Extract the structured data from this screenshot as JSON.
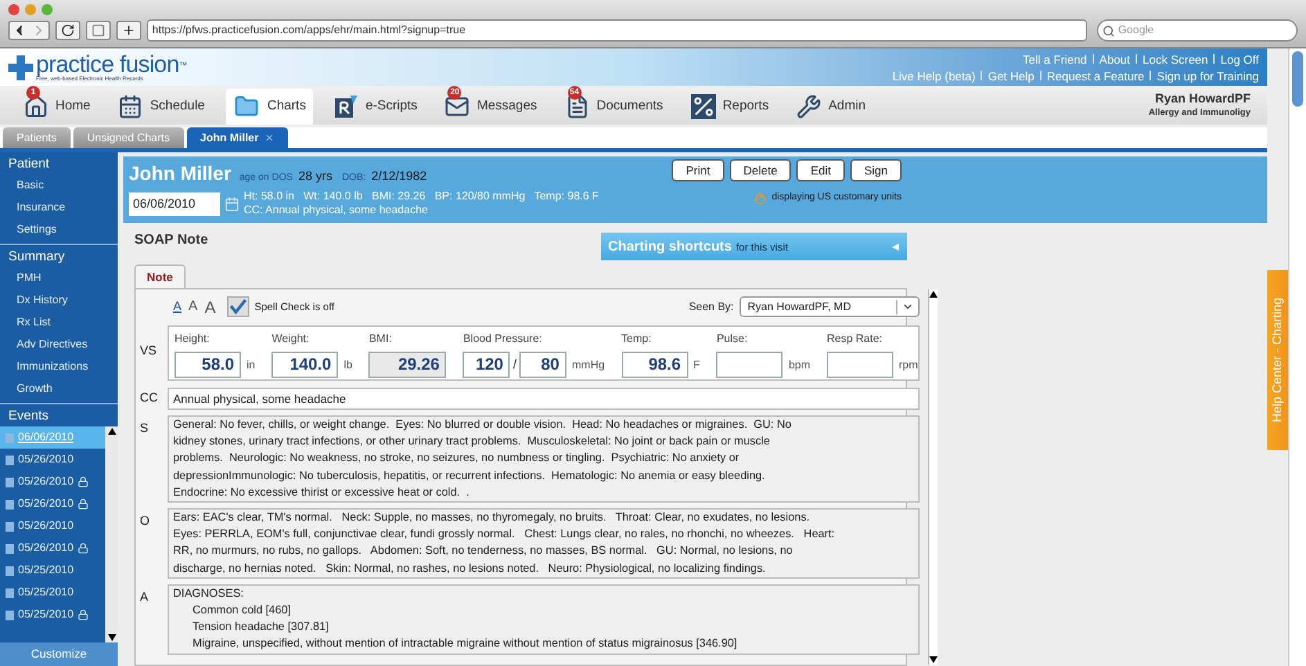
{
  "browser": {
    "url": "https://pfws.practicefusion.com/apps/ehr/main.html?signup=true",
    "search_placeholder": "Google"
  },
  "header": {
    "logo": "practice fusion",
    "logo_mark": "™",
    "tagline": "Free, web-based Electronic Health Records",
    "top_links": [
      "Tell a Friend",
      "About",
      "Lock Screen",
      "Log Off"
    ],
    "help_links": [
      "Live Help (beta)",
      "Get Help",
      "Request a Feature",
      "Sign up for Training"
    ]
  },
  "nav": [
    {
      "kind": "home",
      "label": "Home",
      "badge": "1",
      "selected": false
    },
    {
      "kind": "schedule",
      "label": "Schedule",
      "selected": false
    },
    {
      "kind": "charts",
      "label": "Charts",
      "selected": true
    },
    {
      "kind": "escripts",
      "label": "e-Scripts",
      "selected": false
    },
    {
      "kind": "messages",
      "label": "Messages",
      "badge": "20",
      "selected": false
    },
    {
      "kind": "documents",
      "label": "Documents",
      "badge": "54",
      "selected": false
    },
    {
      "kind": "reports",
      "label": "Reports",
      "selected": false
    },
    {
      "kind": "admin",
      "label": "Admin",
      "selected": false
    }
  ],
  "user": {
    "name": "Ryan HowardPF",
    "specialty": "Allergy and Immunoligy"
  },
  "subtabs": [
    {
      "label": "Patients",
      "selected": false,
      "closable": false
    },
    {
      "label": "Unsigned Charts",
      "selected": false,
      "closable": false
    },
    {
      "label": "John Miller",
      "selected": true,
      "closable": true
    }
  ],
  "sidebar": {
    "sections": [
      {
        "title": "Patient",
        "items": [
          "Basic",
          "Insurance",
          "Settings"
        ]
      },
      {
        "title": "Summary",
        "items": [
          "PMH",
          "Dx History",
          "Rx List",
          "Adv Directives",
          "Immunizations",
          "Growth"
        ]
      }
    ],
    "events": {
      "title": "Events",
      "items": [
        {
          "date": "06/06/2010",
          "selected": true,
          "locked": false
        },
        {
          "date": "05/26/2010",
          "selected": false,
          "locked": false
        },
        {
          "date": "05/26/2010",
          "selected": false,
          "locked": true
        },
        {
          "date": "05/26/2010",
          "selected": false,
          "locked": true
        },
        {
          "date": "05/26/2010",
          "selected": false,
          "locked": false
        },
        {
          "date": "05/26/2010",
          "selected": false,
          "locked": true
        },
        {
          "date": "05/25/2010",
          "selected": false,
          "locked": false
        },
        {
          "date": "05/25/2010",
          "selected": false,
          "locked": false
        },
        {
          "date": "05/25/2010",
          "selected": false,
          "locked": true
        }
      ]
    },
    "customize": "Customize"
  },
  "patient": {
    "name": "John Miller",
    "age_label": "age on DOS",
    "age": "28 yrs",
    "dob_label": "DOB:",
    "dob": "2/12/1982",
    "date": "06/06/2010",
    "vitals_line": "Ht: 58.0 in   Wt: 140.0 lb   BMI: 29.26   BP: 120/80 mmHg   Temp: 98.6 F",
    "cc_line": "CC: Annual physical, some headache",
    "buttons": [
      "Print",
      "Delete",
      "Edit",
      "Sign"
    ],
    "units_note": "displaying US customary units"
  },
  "soap": {
    "title": "SOAP Note",
    "shortcuts": {
      "title": "Charting shortcuts",
      "subtitle": "for this visit"
    },
    "tabs": [
      {
        "label": "Note",
        "selected": true
      }
    ],
    "font_sizes": [
      {
        "label": "A",
        "selected": true
      },
      {
        "label": "A",
        "selected": false
      },
      {
        "label": "A",
        "selected": false
      }
    ],
    "spell_check": "Spell Check is off",
    "seen_by_label": "Seen By:",
    "seen_by": "Ryan HowardPF, MD",
    "vs_label": "VS",
    "vitals": [
      {
        "kind": "input",
        "label": "Height:",
        "value": "58.0",
        "unit": "in"
      },
      {
        "kind": "input",
        "label": "Weight:",
        "value": "140.0",
        "unit": "lb"
      },
      {
        "kind": "readonly",
        "label": "BMI:",
        "value": "29.26"
      },
      {
        "kind": "bp",
        "label": "Blood Pressure:",
        "value": "120",
        "separator": "/",
        "value2": "80",
        "unit": "mmHg"
      },
      {
        "kind": "input",
        "label": "Temp:",
        "value": "98.6",
        "unit": "F"
      },
      {
        "kind": "input",
        "label": "Pulse:",
        "unit": "bpm"
      },
      {
        "kind": "input",
        "label": "Resp Rate:",
        "unit": "rpm"
      }
    ],
    "cc": {
      "letter": "CC",
      "text": "Annual physical, some headache"
    },
    "sections": [
      {
        "letter": "S",
        "lines": [
          "General: No fever, chills, or weight change.  Eyes: No blurred or double vision.  Head: No headaches or migraines.  GU: No",
          "kidney stones, urinary tract infections, or other urinary tract problems.  Musculoskeletal: No joint or back pain or muscle",
          "problems.  Neurologic: No weakness, no stroke, no seizures, no numbness or tingling.  Psychiatric: No anxiety or",
          "depressionImmunologic: No tuberculosis, hepatitis, or recurrent infections.  Hematologic: No anemia or easy bleeding.",
          "Endocrine: No excessive thirist or excessive heat or cold.  ."
        ]
      },
      {
        "letter": "O",
        "lines": [
          "Ears: EAC's clear, TM's normal.   Neck: Supple, no masses, no thyromegaly, no bruits.   Throat: Clear, no exudates, no lesions.",
          "Eyes: PERRLA, EOM's full, conjunctivae clear, fundi grossly normal.   Chest: Lungs clear, no rales, no rhonchi, no wheezes.   Heart:",
          "RR, no murmurs, no rubs, no gallops.   Abdomen: Soft, no tenderness, no masses, BS normal.   GU: Normal, no lesions, no",
          "discharge, no hernias noted.   Skin: Normal, no rashes, no lesions noted.   Neuro: Physiological, no localizing findings."
        ]
      },
      {
        "letter": "A",
        "heading": "DIAGNOSES:",
        "items": [
          "Common cold [460]",
          "Tension headache [307.81]",
          "Migraine, unspecified, without mention of intractable migraine without mention of status migrainosus [346.90]"
        ]
      }
    ]
  },
  "help_tab": "Help Center - Charting"
}
